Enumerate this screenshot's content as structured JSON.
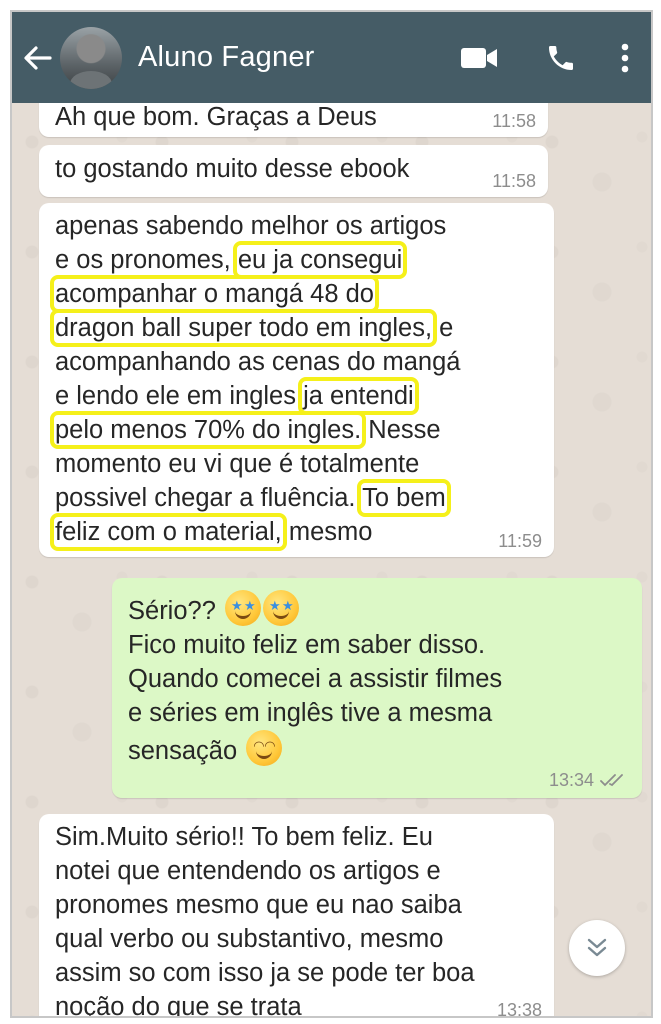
{
  "header": {
    "contact_name": "Aluno Fagner",
    "back_icon": "arrow-left-icon",
    "video_icon": "video-camera-icon",
    "call_icon": "phone-icon",
    "menu_icon": "more-vert-icon",
    "bg_color": "#455c66"
  },
  "messages": [
    {
      "direction": "in",
      "text": "Ah que bom. Graças a Deus",
      "time": "11:58"
    },
    {
      "direction": "in",
      "text": "to gostando muito desse ebook",
      "time": "11:58"
    },
    {
      "direction": "in",
      "lines": [
        "apenas sabendo melhor os artigos",
        "e os pronomes, ",
        "eu ja consegui",
        "acompanhar o mangá 48 do",
        "dragon ball super todo em ingles,",
        " e",
        "acompanhando as cenas do mangá",
        "e lendo ele em ingles ",
        "ja entendi",
        "pelo menos 70% do ingles.",
        " Nesse",
        "momento eu vi que é totalmente",
        "possivel chegar a fluência. ",
        "To bem",
        "feliz com o material,",
        " mesmo"
      ],
      "time": "11:59"
    },
    {
      "direction": "out",
      "line1": "Sério??",
      "line2": "Fico muito feliz em saber disso.",
      "line3": "Quando comecei a assistir filmes",
      "line4": "e séries em inglês tive a mesma",
      "line5": "sensação",
      "time": "13:34",
      "status": "read",
      "emojis": [
        "star-struck-icon",
        "star-struck-icon",
        "smiling-face-icon"
      ]
    },
    {
      "direction": "in",
      "lines": [
        "Sim.Muito sério!! To bem feliz. Eu",
        "notei que entendendo os artigos e",
        "pronomes mesmo que eu nao saiba",
        "qual verbo ou substantivo, mesmo",
        "assim so com isso ja se pode ter boa",
        "noção do que se trata"
      ],
      "time": "13:38"
    }
  ],
  "scroll_down_icon": "chevron-double-down-icon",
  "colors": {
    "incoming_bubble": "#ffffff",
    "outgoing_bubble": "#dcf8c6",
    "highlight": "#f5f01a",
    "chat_bg": "#e5ddd5"
  }
}
